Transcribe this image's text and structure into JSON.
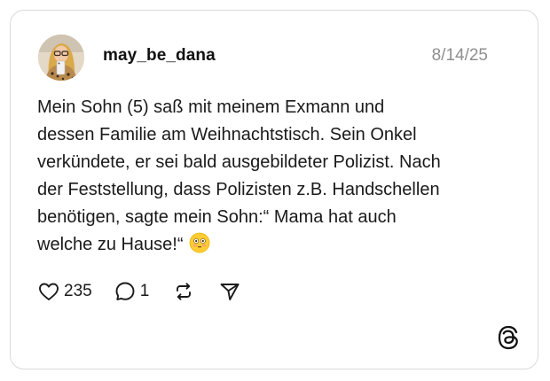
{
  "post": {
    "username": "may_be_dana",
    "date": "8/14/25",
    "text_lines": [
      "Mein Sohn (5) saß mit meinem Exmann und",
      "dessen Familie am Weihnachtstisch. Sein Onkel",
      "verkündete, er sei bald ausgebildeter Polizist. Nach",
      "der Feststellung, dass Polizisten z.B. Handschellen",
      "benötigen, sagte mein Sohn:“ Mama hat auch",
      "welche zu Hause!“"
    ],
    "emoji": "flushed-face"
  },
  "actions": {
    "like_count": "235",
    "reply_count": "1",
    "like_icon": "heart-icon",
    "reply_icon": "comment-bubble-icon",
    "repost_icon": "repost-icon",
    "share_icon": "send-icon"
  },
  "brand": {
    "logo": "threads-logo-icon"
  },
  "colors": {
    "border": "#dadada",
    "date": "#8f8f8f",
    "text": "#1a1a1a"
  }
}
